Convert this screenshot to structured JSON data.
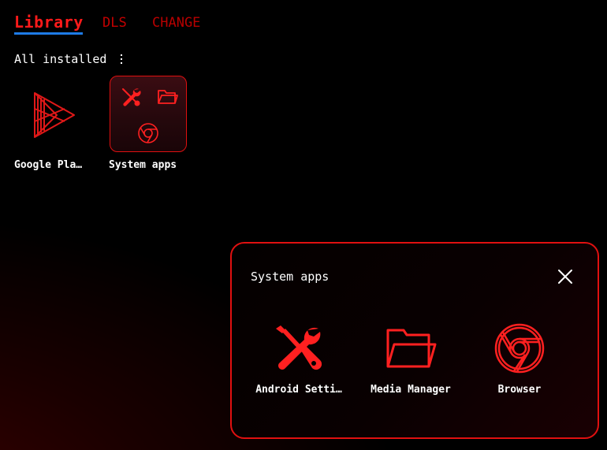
{
  "tabs": {
    "library": "Library",
    "dls": "DLS",
    "change": "CHANGE"
  },
  "section": {
    "label": "All installed"
  },
  "apps": [
    {
      "label": "Google Pla…",
      "icon": "google-play-icon"
    },
    {
      "label": "System apps",
      "icon": "folder-thumbnail"
    }
  ],
  "popup": {
    "title": "System apps",
    "apps": [
      {
        "label": "Android Setti…",
        "icon": "tools-icon"
      },
      {
        "label": "Media Manager",
        "icon": "folder-icon"
      },
      {
        "label": "Browser",
        "icon": "chrome-icon"
      }
    ]
  },
  "colors": {
    "accent_red": "#e01010",
    "tab_active": "#ff1a1a",
    "tab_underline": "#1e7be6",
    "background": "#000000"
  }
}
